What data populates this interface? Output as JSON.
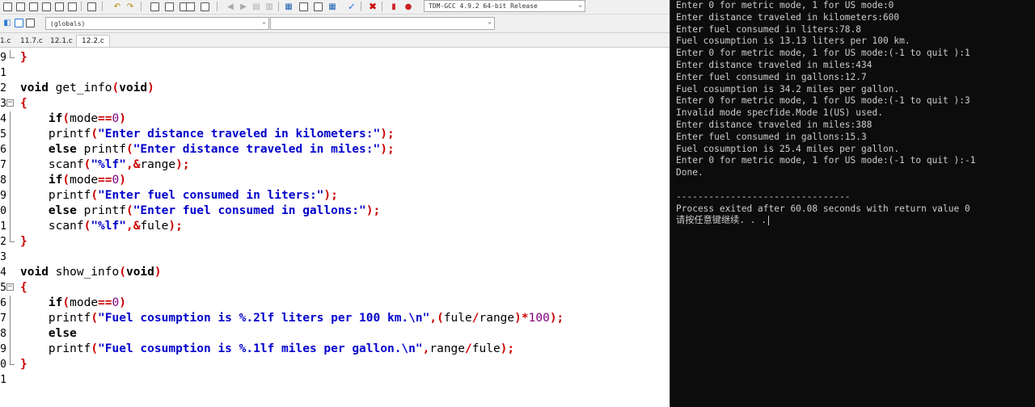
{
  "toolbar": {
    "compiler_select": "TDM-GCC 4.9.2 64-bit Release",
    "scope_select": "(globals)",
    "member_select": ""
  },
  "tabs": [
    {
      "label": "1.c",
      "active": false
    },
    {
      "label": "11.7.c",
      "active": false
    },
    {
      "label": "12.1.c",
      "active": false
    },
    {
      "label": "12.2.c",
      "active": true
    }
  ],
  "editor": {
    "lines": [
      {
        "num": "9",
        "fold": "end",
        "tokens": [
          [
            "sym",
            "}"
          ]
        ]
      },
      {
        "num": "1",
        "fold": "",
        "tokens": []
      },
      {
        "num": "2",
        "fold": "",
        "tokens": [
          [
            "kw",
            "void"
          ],
          [
            "plain",
            " get_info"
          ],
          [
            "sym",
            "("
          ],
          [
            "kw",
            "void"
          ],
          [
            "sym",
            ")"
          ]
        ]
      },
      {
        "num": "3",
        "fold": "box",
        "tokens": [
          [
            "sym",
            "{"
          ]
        ]
      },
      {
        "num": "4",
        "fold": "mid",
        "tokens": [
          [
            "plain",
            "    "
          ],
          [
            "kw",
            "if"
          ],
          [
            "sym",
            "("
          ],
          [
            "plain",
            "mode"
          ],
          [
            "sym",
            "=="
          ],
          [
            "num",
            "0"
          ],
          [
            "sym",
            ")"
          ]
        ]
      },
      {
        "num": "5",
        "fold": "mid",
        "tokens": [
          [
            "plain",
            "    printf"
          ],
          [
            "sym",
            "("
          ],
          [
            "str",
            "\"Enter distance traveled in kilometers:\""
          ],
          [
            "sym",
            ");"
          ]
        ]
      },
      {
        "num": "6",
        "fold": "mid",
        "tokens": [
          [
            "plain",
            "    "
          ],
          [
            "kw",
            "else"
          ],
          [
            "plain",
            " printf"
          ],
          [
            "sym",
            "("
          ],
          [
            "str",
            "\"Enter distance traveled in miles:\""
          ],
          [
            "sym",
            ");"
          ]
        ]
      },
      {
        "num": "7",
        "fold": "mid",
        "tokens": [
          [
            "plain",
            "    scanf"
          ],
          [
            "sym",
            "("
          ],
          [
            "str",
            "\"%lf\""
          ],
          [
            "sym",
            ",&"
          ],
          [
            "plain",
            "range"
          ],
          [
            "sym",
            ");"
          ]
        ]
      },
      {
        "num": "8",
        "fold": "mid",
        "tokens": [
          [
            "plain",
            "    "
          ],
          [
            "kw",
            "if"
          ],
          [
            "sym",
            "("
          ],
          [
            "plain",
            "mode"
          ],
          [
            "sym",
            "=="
          ],
          [
            "num",
            "0"
          ],
          [
            "sym",
            ")"
          ]
        ]
      },
      {
        "num": "9",
        "fold": "mid",
        "tokens": [
          [
            "plain",
            "    printf"
          ],
          [
            "sym",
            "("
          ],
          [
            "str",
            "\"Enter fuel consumed in liters:\""
          ],
          [
            "sym",
            ");"
          ]
        ]
      },
      {
        "num": "0",
        "fold": "mid",
        "tokens": [
          [
            "plain",
            "    "
          ],
          [
            "kw",
            "else"
          ],
          [
            "plain",
            " printf"
          ],
          [
            "sym",
            "("
          ],
          [
            "str",
            "\"Enter fuel consumed in gallons:\""
          ],
          [
            "sym",
            ");"
          ]
        ]
      },
      {
        "num": "1",
        "fold": "mid",
        "tokens": [
          [
            "plain",
            "    scanf"
          ],
          [
            "sym",
            "("
          ],
          [
            "str",
            "\"%lf\""
          ],
          [
            "sym",
            ",&"
          ],
          [
            "plain",
            "fule"
          ],
          [
            "sym",
            ");"
          ]
        ]
      },
      {
        "num": "2",
        "fold": "end",
        "tokens": [
          [
            "sym",
            "}"
          ]
        ]
      },
      {
        "num": "3",
        "fold": "",
        "tokens": []
      },
      {
        "num": "4",
        "fold": "",
        "tokens": [
          [
            "kw",
            "void"
          ],
          [
            "plain",
            " show_info"
          ],
          [
            "sym",
            "("
          ],
          [
            "kw",
            "void"
          ],
          [
            "sym",
            ")"
          ]
        ]
      },
      {
        "num": "5",
        "fold": "box",
        "tokens": [
          [
            "sym",
            "{"
          ]
        ]
      },
      {
        "num": "6",
        "fold": "mid",
        "tokens": [
          [
            "plain",
            "    "
          ],
          [
            "kw",
            "if"
          ],
          [
            "sym",
            "("
          ],
          [
            "plain",
            "mode"
          ],
          [
            "sym",
            "=="
          ],
          [
            "num",
            "0"
          ],
          [
            "sym",
            ")"
          ]
        ]
      },
      {
        "num": "7",
        "fold": "mid",
        "tokens": [
          [
            "plain",
            "    printf"
          ],
          [
            "sym",
            "("
          ],
          [
            "str",
            "\"Fuel cosumption is %.2lf liters per 100 km.\\n\""
          ],
          [
            "sym",
            ",("
          ],
          [
            "plain",
            "fule"
          ],
          [
            "sym",
            "/"
          ],
          [
            "plain",
            "range"
          ],
          [
            "sym",
            ")*"
          ],
          [
            "num",
            "100"
          ],
          [
            "sym",
            ");"
          ]
        ]
      },
      {
        "num": "8",
        "fold": "mid",
        "tokens": [
          [
            "plain",
            "    "
          ],
          [
            "kw",
            "else"
          ]
        ]
      },
      {
        "num": "9",
        "fold": "mid",
        "tokens": [
          [
            "plain",
            "    printf"
          ],
          [
            "sym",
            "("
          ],
          [
            "str",
            "\"Fuel cosumption is %.1lf miles per gallon.\\n\""
          ],
          [
            "sym",
            ","
          ],
          [
            "plain",
            "range"
          ],
          [
            "sym",
            "/"
          ],
          [
            "plain",
            "fule"
          ],
          [
            "sym",
            ");"
          ]
        ]
      },
      {
        "num": "0",
        "fold": "end",
        "tokens": [
          [
            "sym",
            "}"
          ]
        ]
      },
      {
        "num": "1",
        "fold": "",
        "tokens": []
      }
    ]
  },
  "console": {
    "lines": [
      "Enter 0 for metric mode, 1 for US mode:0",
      "Enter distance traveled in kilometers:600",
      "Enter fuel consumed in liters:78.8",
      "Fuel cosumption is 13.13 liters per 100 km.",
      "Enter 0 for metric mode, 1 for US mode:(-1 to quit ):1",
      "Enter distance traveled in miles:434",
      "Enter fuel consumed in gallons:12.7",
      "Fuel cosumption is 34.2 miles per gallon.",
      "Enter 0 for metric mode, 1 for US mode:(-1 to quit ):3",
      "Invalid mode specfide.Mode 1(US) used.",
      "Enter distance traveled in miles:388",
      "Enter fuel consumed in gallons:15.3",
      "Fuel cosumption is 25.4 miles per gallon.",
      "Enter 0 for metric mode, 1 for US mode:(-1 to quit ):-1",
      "Done.",
      "",
      "--------------------------------",
      "Process exited after 60.08 seconds with return value 0",
      "请按任意键继续. . ."
    ]
  }
}
